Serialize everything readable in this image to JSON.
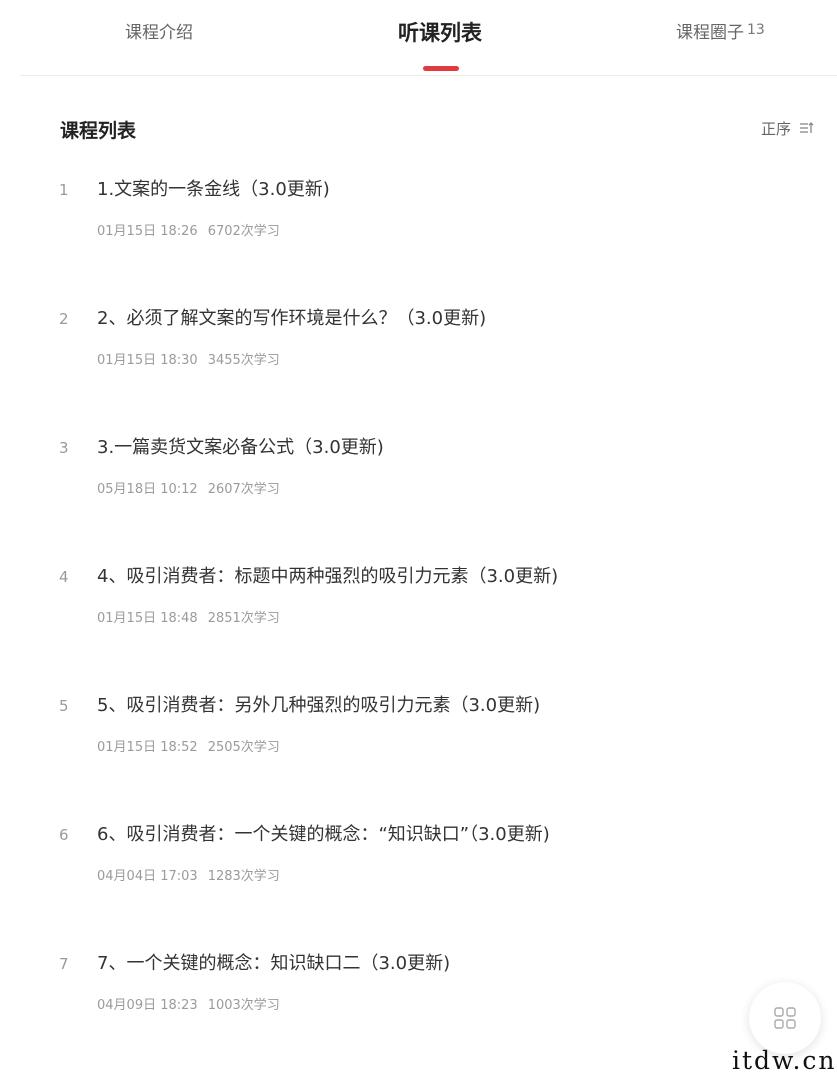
{
  "tabs": [
    {
      "label": "课程介绍"
    },
    {
      "label": "听课列表",
      "active": true
    },
    {
      "label": "课程圈子",
      "count": "13"
    }
  ],
  "accent_color": "#e13b3f",
  "section": {
    "title": "课程列表",
    "sort_label": "正序",
    "sort_icon": "sort-icon"
  },
  "lessons": [
    {
      "index": "1",
      "title": "1.文案的一条金线（3.0更新)",
      "date": "01月15日 18:26",
      "views": "6702次学习"
    },
    {
      "index": "2",
      "title": "2、必须了解文案的写作环境是什么？（3.0更新)",
      "date": "01月15日 18:30",
      "views": "3455次学习"
    },
    {
      "index": "3",
      "title": "3.一篇卖货文案必备公式（3.0更新)",
      "date": "05月18日 10:12",
      "views": "2607次学习"
    },
    {
      "index": "4",
      "title": "4、吸引消费者：标题中两种强烈的吸引力元素（3.0更新)",
      "date": "01月15日 18:48",
      "views": "2851次学习"
    },
    {
      "index": "5",
      "title": "5、吸引消费者：另外几种强烈的吸引力元素（3.0更新)",
      "date": "01月15日 18:52",
      "views": "2505次学习"
    },
    {
      "index": "6",
      "title": "6、吸引消费者：一个关键的概念：“知识缺口”（3.0更新)",
      "date": "04月04日 17:03",
      "views": "1283次学习"
    },
    {
      "index": "7",
      "title": "7、一个关键的概念：知识缺口二（3.0更新)",
      "date": "04月09日 18:23",
      "views": "1003次学习"
    }
  ],
  "fab": {
    "icon": "grid-icon"
  },
  "watermark": "itdw.cn"
}
